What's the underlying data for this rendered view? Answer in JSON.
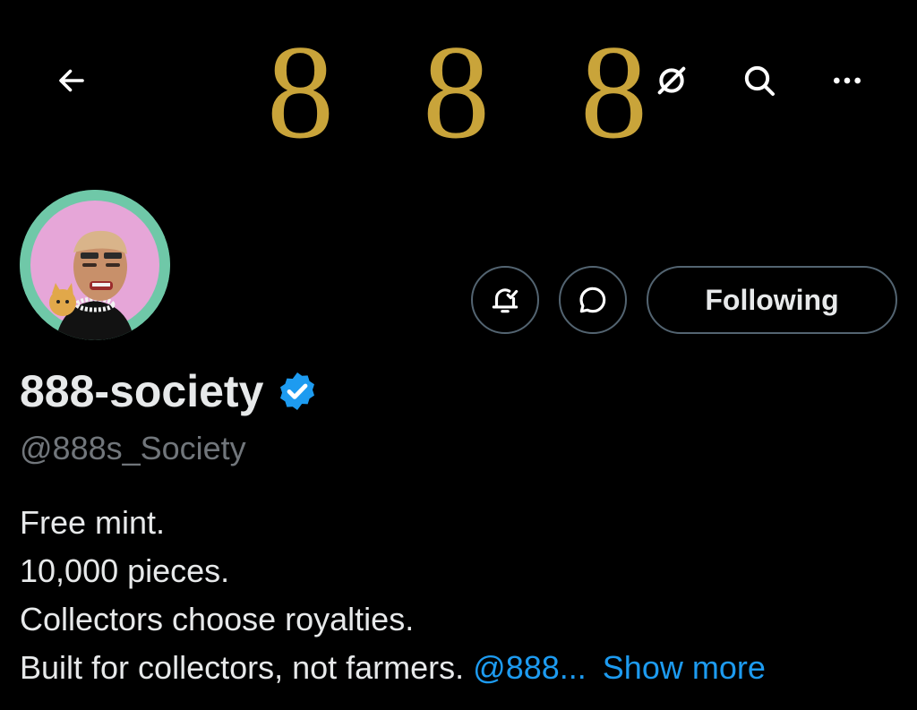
{
  "banner": {
    "digits": [
      "8",
      "8",
      "8"
    ],
    "color": "#c9a43a"
  },
  "topbar": {
    "back_icon": "arrow-left-icon",
    "grok_icon": "slashed-circle-icon",
    "search_icon": "search-icon",
    "more_icon": "more-horizontal-icon"
  },
  "profile": {
    "avatar_icon": "avatar-image",
    "display_name": "888-society",
    "verified_icon": "verified-badge-icon",
    "verified_color": "#1d9bf0",
    "handle": "@888s_Society"
  },
  "actions": {
    "notify_icon": "bell-check-icon",
    "message_icon": "chat-bubble-icon",
    "following_label": "Following"
  },
  "bio": {
    "line1": "Free mint.",
    "line2": "10,000 pieces.",
    "line3": "Collectors choose royalties.",
    "line4_text": "Built for collectors, not farmers. ",
    "line4_mention": "@888...",
    "show_more": "Show more"
  },
  "colors": {
    "background": "#000000",
    "text_primary": "#e7e9ea",
    "text_secondary": "#71767b",
    "link": "#1d9bf0",
    "border": "#536471"
  }
}
